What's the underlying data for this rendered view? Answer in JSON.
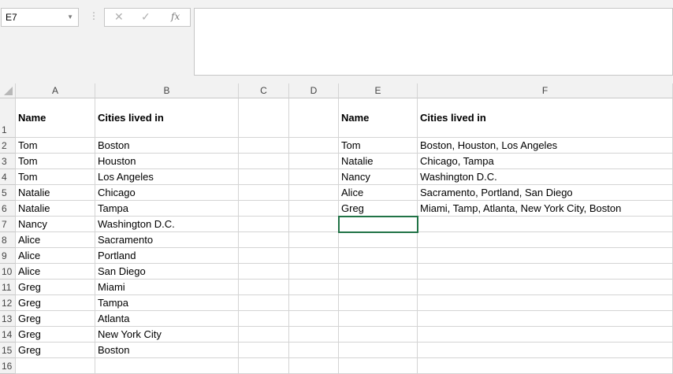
{
  "name_box": {
    "value": "E7"
  },
  "formula_bar": {
    "cancel_icon": "close-icon",
    "enter_icon": "check-icon",
    "fx_label": "fx",
    "value": ""
  },
  "columns": [
    "A",
    "B",
    "C",
    "D",
    "E",
    "F"
  ],
  "rows": [
    "1",
    "2",
    "3",
    "4",
    "5",
    "6",
    "7",
    "8",
    "9",
    "10",
    "11",
    "12",
    "13",
    "14",
    "15",
    "16"
  ],
  "selected_cell": "E7",
  "cells": {
    "A1": "Name",
    "B1": "Cities lived in",
    "E1": "Name",
    "F1": "Cities lived in",
    "A2": "Tom",
    "B2": "Boston",
    "E2": "Tom",
    "F2": "Boston, Houston, Los Angeles",
    "A3": "Tom",
    "B3": "Houston",
    "E3": "Natalie",
    "F3": "Chicago, Tampa",
    "A4": "Tom",
    "B4": "Los Angeles",
    "E4": "Nancy",
    "F4": "Washington D.C.",
    "A5": "Natalie",
    "B5": "Chicago",
    "E5": "Alice",
    "F5": "Sacramento, Portland, San Diego",
    "A6": "Natalie",
    "B6": "Tampa",
    "E6": "Greg",
    "F6": "Miami, Tamp, Atlanta, New York City, Boston",
    "A7": "Nancy",
    "B7": "Washington D.C.",
    "A8": "Alice",
    "B8": "Sacramento",
    "A9": "Alice",
    "B9": "Portland",
    "A10": "Alice",
    "B10": "San Diego",
    "A11": "Greg",
    "B11": "Miami",
    "A12": "Greg",
    "B12": "Tampa",
    "A13": "Greg",
    "B13": "Atlanta",
    "A14": "Greg",
    "B14": "New York City",
    "A15": "Greg",
    "B15": "Boston"
  }
}
